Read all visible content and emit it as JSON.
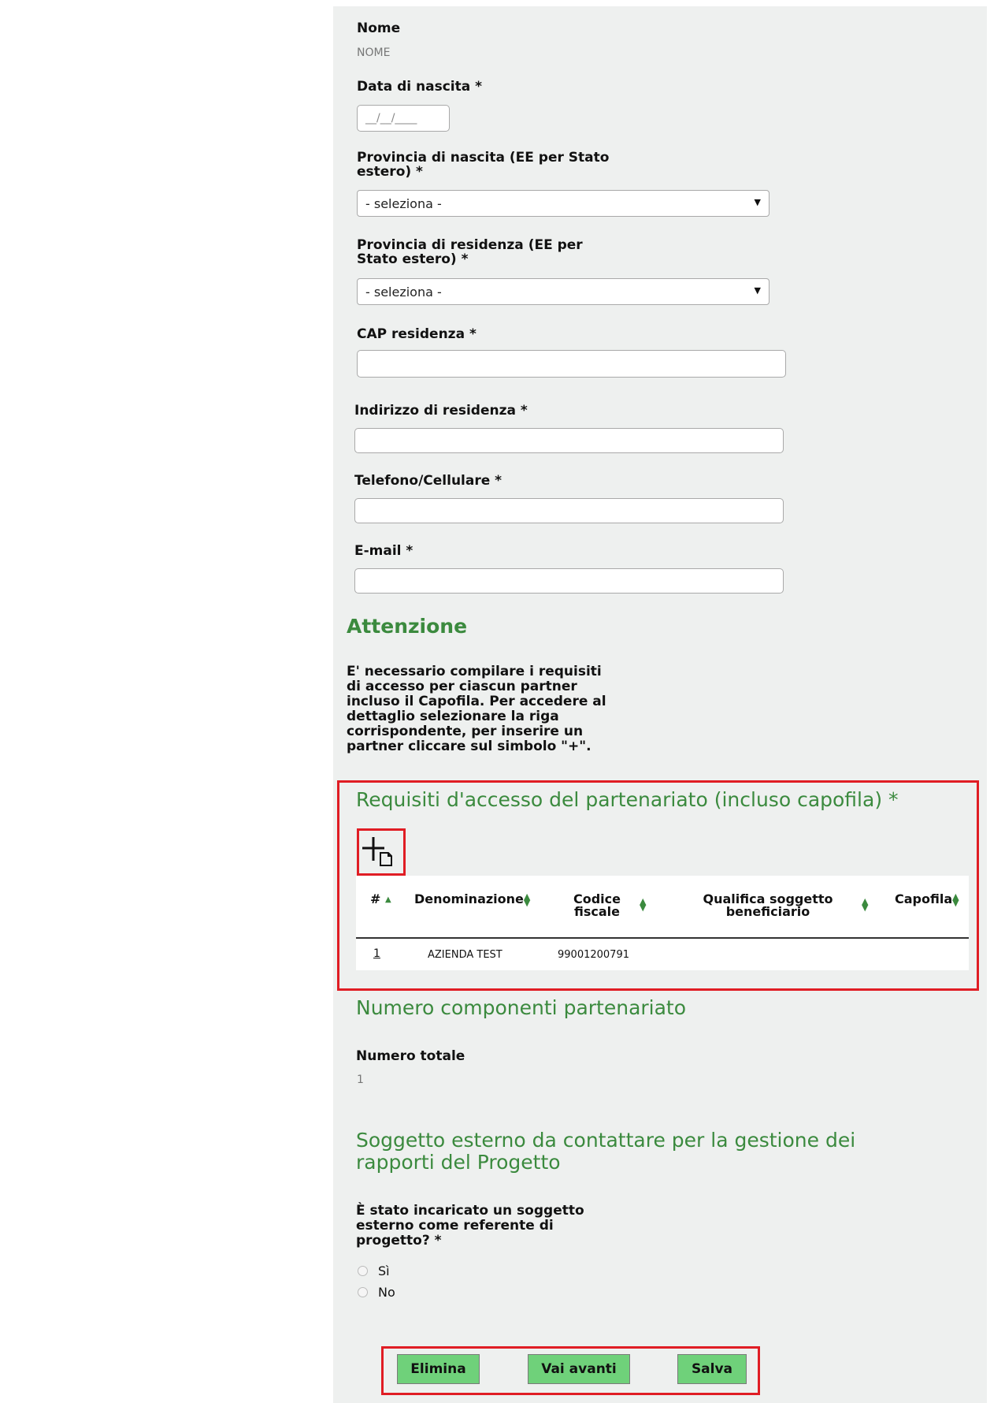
{
  "person": {
    "nome_label": "Nome",
    "nome_value": "NOME",
    "data_nascita_label": "Data di nascita *",
    "data_nascita_placeholder": "__/__/____",
    "prov_nascita_label": "Provincia di nascita (EE per Stato estero) *",
    "prov_nascita_value": "- seleziona -",
    "prov_residenza_label": "Provincia di residenza (EE per Stato estero) *",
    "prov_residenza_value": "- seleziona -",
    "cap_label": "CAP residenza *",
    "indirizzo_label": "Indirizzo di residenza *",
    "telefono_label": "Telefono/Cellulare *",
    "email_label": "E-mail *"
  },
  "attenzione": {
    "title": "Attenzione",
    "text": "E' necessario compilare i requisiti di accesso per ciascun partner incluso il Capofila. Per accedere al dettaglio selezionare la riga corrispondente, per inserire un partner cliccare sul simbolo \"+\"."
  },
  "requisiti": {
    "title": "Requisiti d'accesso del partenariato (incluso capofila) *",
    "columns": [
      "#",
      "Denominazione",
      "Codice fiscale",
      "Qualifica soggetto beneficiario",
      "Capofila"
    ],
    "rows": [
      {
        "num": "1",
        "denominazione": "AZIENDA TEST",
        "codice_fiscale": "99001200791",
        "qualifica": "",
        "capofila": ""
      }
    ]
  },
  "numero": {
    "title": "Numero componenti partenariato",
    "label": "Numero totale",
    "value": "1"
  },
  "soggetto": {
    "title": "Soggetto esterno da contattare per la gestione dei rapporti del Progetto",
    "question": "È stato incaricato un soggetto esterno come referente di progetto? *",
    "options": [
      "Sì",
      "No"
    ]
  },
  "buttons": {
    "elimina": "Elimina",
    "vai_avanti": "Vai avanti",
    "salva": "Salva"
  },
  "colors": {
    "accent_green": "#3b8a3e",
    "button_green": "#6fd17a",
    "highlight_red": "#e01d24"
  }
}
